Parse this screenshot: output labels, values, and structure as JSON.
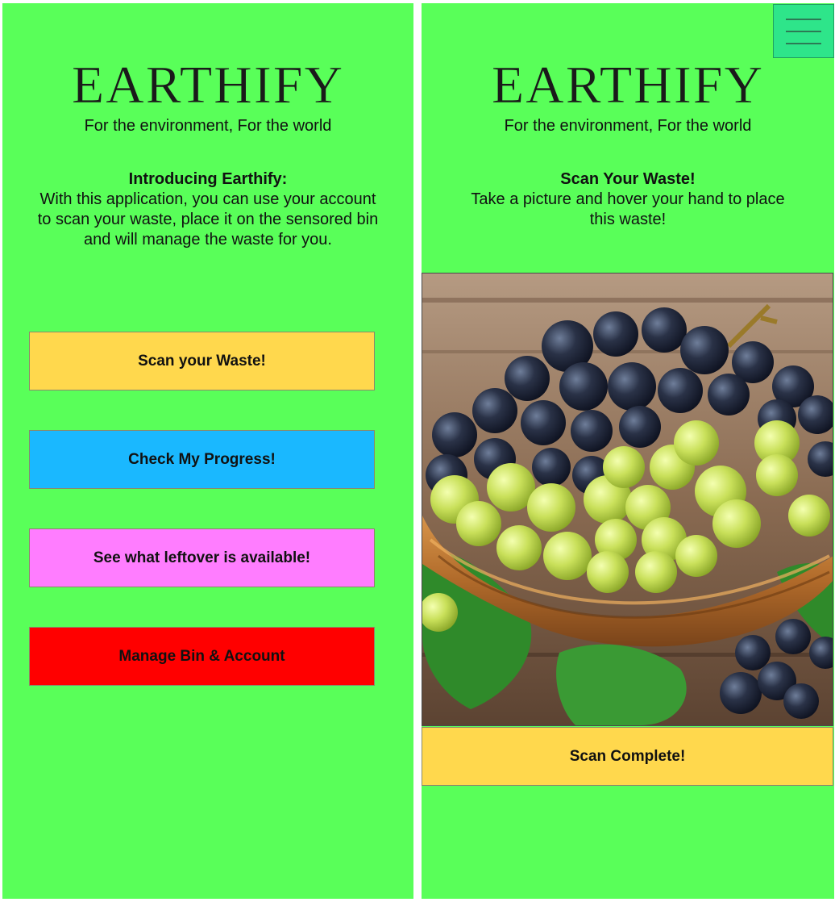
{
  "app": {
    "logo": "EARTHIFY",
    "tagline": "For the environment, For the world"
  },
  "home": {
    "intro_heading": "Introducing Earthify:",
    "intro_body": "With this application, you can use your account to scan your waste, place it on the sensored bin and will manage the waste for you.",
    "buttons": [
      {
        "label": "Scan your Waste!",
        "color": "#ffd84d"
      },
      {
        "label": "Check My Progress!",
        "color": "#1ab8ff"
      },
      {
        "label": "See what leftover is available!",
        "color": "#ff7dff"
      },
      {
        "label": "Manage Bin & Account",
        "color": "#ff0000"
      }
    ]
  },
  "scan": {
    "heading": "Scan Your Waste!",
    "body": "Take a picture and hover your hand to place this waste!",
    "photo_subject": "grapes-in-basket",
    "complete_label": "Scan Complete!"
  },
  "colors": {
    "background": "#59ff59",
    "menu_button": "#2ee58a"
  }
}
